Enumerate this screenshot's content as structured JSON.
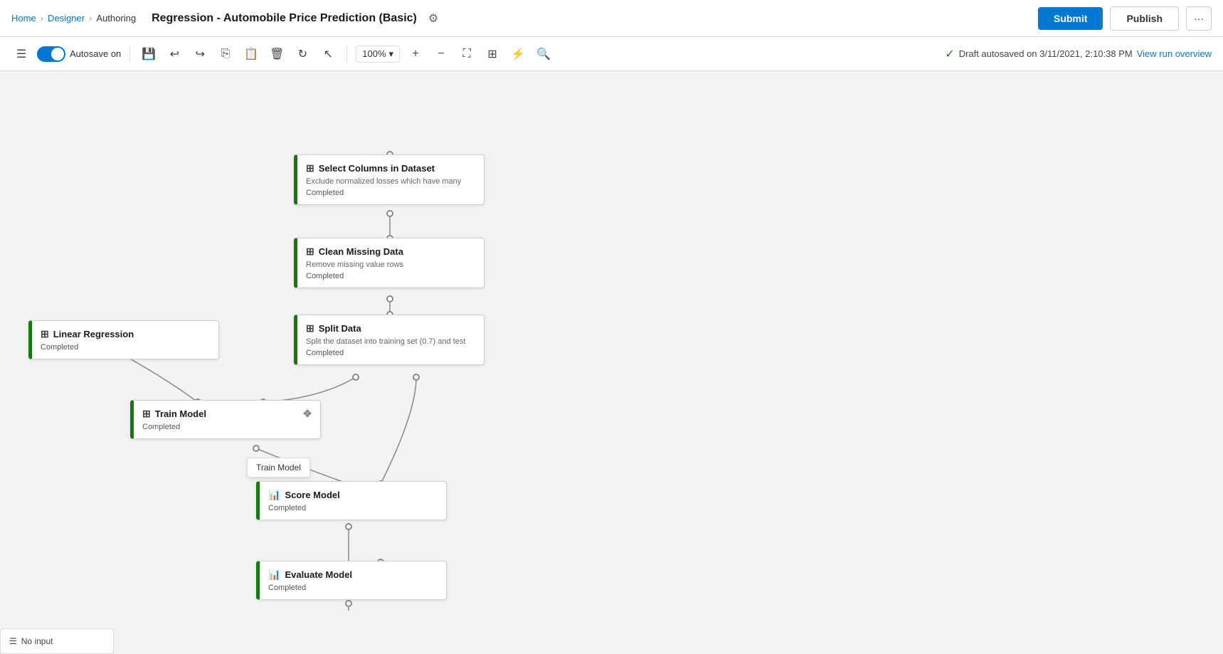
{
  "breadcrumb": {
    "home": "Home",
    "designer": "Designer",
    "current": "Authoring"
  },
  "page": {
    "title": "Regression - Automobile Price Prediction (Basic)"
  },
  "toolbar": {
    "autosave_label": "Autosave on",
    "zoom": "100%",
    "autosave_status": "Draft autosaved on 3/11/2021, 2:10:38 PM",
    "view_run": "View run overview",
    "submit_label": "Submit",
    "publish_label": "Publish"
  },
  "nodes": {
    "select_columns": {
      "title": "Select Columns in Dataset",
      "desc": "Exclude normalized losses which have many",
      "status": "Completed"
    },
    "clean_missing": {
      "title": "Clean Missing Data",
      "desc": "Remove missing value rows",
      "status": "Completed"
    },
    "split_data": {
      "title": "Split Data",
      "desc": "Split the dataset into training set (0.7) and test",
      "status": "Completed"
    },
    "linear_regression": {
      "title": "Linear Regression",
      "status": "Completed"
    },
    "train_model": {
      "title": "Train Model",
      "status": "Completed"
    },
    "score_model": {
      "title": "Score Model",
      "status": "Completed"
    },
    "evaluate_model": {
      "title": "Evaluate Model",
      "status": "Completed"
    }
  },
  "tooltip": {
    "train_model": "Train Model"
  }
}
